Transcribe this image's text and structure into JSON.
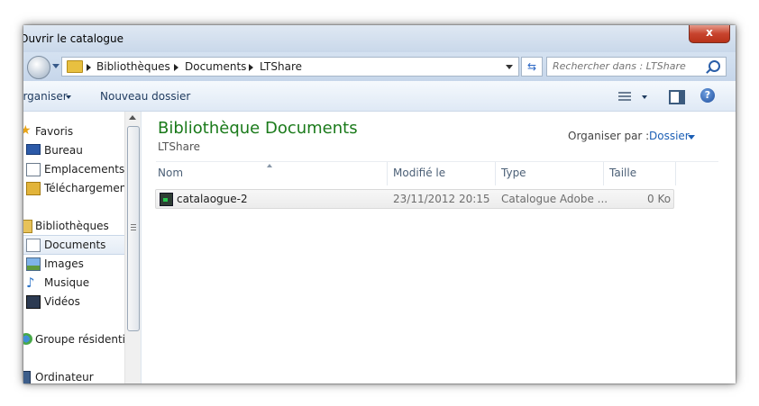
{
  "window": {
    "title": "Ouvrir le catalogue",
    "close_label": "x"
  },
  "address": {
    "crumbs": [
      "Bibliothèques",
      "Documents",
      "LTShare"
    ],
    "search_placeholder": "Rechercher dans : LTShare"
  },
  "toolbar": {
    "organize_label": "Organiser",
    "new_folder_label": "Nouveau dossier",
    "help_label": "?"
  },
  "sidebar": {
    "items": [
      {
        "label": "Favoris",
        "icon": "star-icon"
      },
      {
        "label": "Bureau",
        "icon": "desktop-icon"
      },
      {
        "label": "Emplacements ré",
        "icon": "recent-places-icon"
      },
      {
        "label": "Téléchargements",
        "icon": "downloads-icon"
      },
      {
        "label": "Bibliothèques",
        "icon": "libraries-icon"
      },
      {
        "label": "Documents",
        "icon": "documents-icon",
        "selected": true
      },
      {
        "label": "Images",
        "icon": "pictures-icon"
      },
      {
        "label": "Musique",
        "icon": "music-icon"
      },
      {
        "label": "Vidéos",
        "icon": "videos-icon"
      },
      {
        "label": "Groupe résidentiel",
        "icon": "homegroup-icon"
      },
      {
        "label": "Ordinateur",
        "icon": "computer-icon"
      }
    ]
  },
  "content": {
    "library_title": "Bibliothèque Documents",
    "library_subtitle": "LTShare",
    "arrange_by_label": "Organiser par :",
    "arrange_by_value": "Dossier",
    "columns": [
      "Nom",
      "Modifié le",
      "Type",
      "Taille"
    ],
    "files": [
      {
        "name": "catalaogue-2",
        "modified": "23/11/2012 20:15",
        "type": "Catalogue Adobe ...",
        "size": "0 Ko",
        "icon": "lightroom-catalog-icon"
      }
    ]
  },
  "colors": {
    "library_title": "#1a7a1a",
    "link_blue": "#1c5fb5",
    "titlebar": "#c9d8ea"
  }
}
